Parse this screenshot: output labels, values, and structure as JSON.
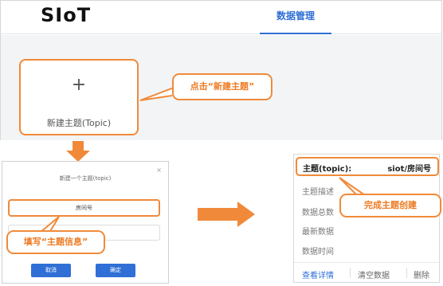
{
  "top": {
    "logo": "SIoT",
    "nav_tab": "数据管理",
    "new_card_plus": "+",
    "new_card_label": "新建主题(Topic)",
    "callout": "点击“新建主题”"
  },
  "dialog": {
    "title": "新建一个主题(topic)",
    "close": "×",
    "input_value": "房间号",
    "callout": "填写“主题信息”",
    "cancel": "取消",
    "confirm": "确定"
  },
  "topic_card": {
    "head_key": "主题(topic):",
    "head_value": "siot/房间号",
    "rows": [
      "主题描述",
      "数据总数",
      "最新数据",
      "数据时间"
    ],
    "callout": "完成主题创建",
    "footer": [
      "查看详情",
      "清空数据",
      "删除"
    ]
  },
  "colors": {
    "accent": "#f08a3a",
    "brand_blue": "#2f6fd6"
  },
  "icons": {
    "down_arrow": "down-arrow-icon",
    "right_arrow": "right-arrow-icon"
  }
}
